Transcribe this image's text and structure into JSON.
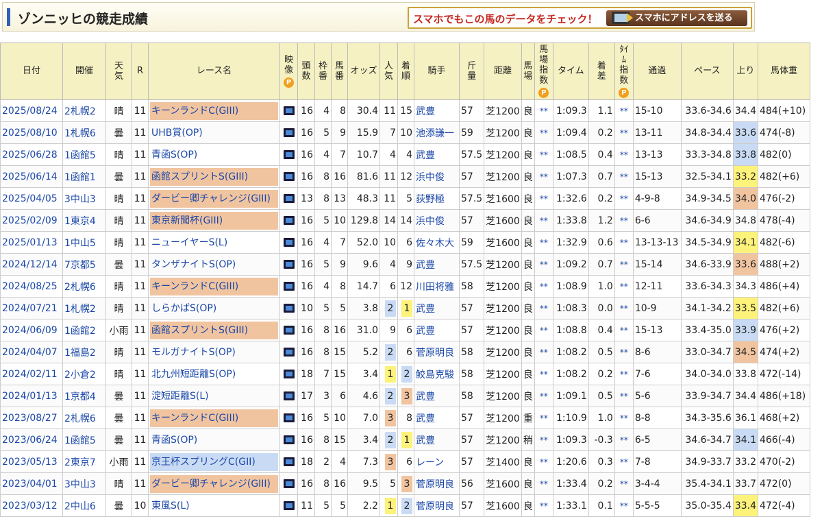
{
  "header": {
    "title": "ゾンニッヒの競走成績",
    "promo_text": "スマホでもこの馬のデータをチェック！",
    "promo_button": "スマホにアドレスを送る"
  },
  "columns": [
    "日付",
    "開催",
    "天気",
    "R",
    "レース名",
    "映像",
    "頭数",
    "枠番",
    "馬番",
    "オッズ",
    "人気",
    "着順",
    "騎手",
    "斤量",
    "距離",
    "馬場",
    "馬場指数",
    "タイム",
    "着差",
    "ﾀｲﾑ指数",
    "通過",
    "ペース",
    "上り",
    "馬体重"
  ],
  "p_mark": "P",
  "rows": [
    {
      "date": "2025/08/24",
      "kaisai": "2札幌2",
      "weather": "晴",
      "r": "11",
      "race": "キーンランドC(GIII)",
      "grade": "g3",
      "heads": "16",
      "waku": "4",
      "uma": "8",
      "odds": "30.4",
      "ninki": "11",
      "rank": "15",
      "jockey": "武豊",
      "kinryo": "57",
      "dist": "芝1200",
      "baba": "良",
      "bsi": "**",
      "time": "1:09.3",
      "diff": "1.1",
      "ti": "**",
      "pass": "15-10",
      "pace": "33.6-34.6",
      "agari": "34.4",
      "weight": "484(+10)"
    },
    {
      "date": "2025/08/10",
      "kaisai": "1札幌6",
      "weather": "曇",
      "r": "11",
      "race": "UHB賞(OP)",
      "grade": "",
      "heads": "16",
      "waku": "5",
      "uma": "9",
      "odds": "15.9",
      "ninki": "7",
      "rank": "10",
      "jockey": "池添謙一",
      "kinryo": "59",
      "dist": "芝1200",
      "baba": "良",
      "bsi": "**",
      "time": "1:09.4",
      "diff": "0.2",
      "ti": "**",
      "pass": "13-11",
      "pace": "34.8-34.4",
      "agari": "33.6",
      "agari_c": "up-b",
      "weight": "474(-8)"
    },
    {
      "date": "2025/06/28",
      "kaisai": "1函館5",
      "weather": "晴",
      "r": "11",
      "race": "青函S(OP)",
      "grade": "",
      "heads": "16",
      "waku": "4",
      "uma": "7",
      "odds": "10.7",
      "ninki": "4",
      "rank": "4",
      "jockey": "武豊",
      "kinryo": "57.5",
      "dist": "芝1200",
      "baba": "良",
      "bsi": "**",
      "time": "1:08.5",
      "diff": "0.4",
      "ti": "**",
      "pass": "13-13",
      "pace": "33.3-34.8",
      "agari": "33.8",
      "agari_c": "up-b",
      "weight": "482(0)"
    },
    {
      "date": "2025/06/14",
      "kaisai": "1函館1",
      "weather": "曇",
      "r": "11",
      "race": "函館スプリントS(GIII)",
      "grade": "g3",
      "heads": "16",
      "waku": "8",
      "uma": "16",
      "odds": "81.6",
      "ninki": "11",
      "rank": "12",
      "jockey": "浜中俊",
      "kinryo": "57",
      "dist": "芝1200",
      "baba": "良",
      "bsi": "**",
      "time": "1:07.3",
      "diff": "0.7",
      "ti": "**",
      "pass": "15-13",
      "pace": "32.5-34.1",
      "agari": "33.2",
      "agari_c": "up-y",
      "weight": "482(+6)"
    },
    {
      "date": "2025/04/05",
      "kaisai": "3中山3",
      "weather": "晴",
      "r": "11",
      "race": "ダービー卿チャレンジ(GIII)",
      "grade": "g3",
      "heads": "13",
      "waku": "8",
      "uma": "13",
      "odds": "48.3",
      "ninki": "11",
      "rank": "5",
      "jockey": "荻野極",
      "kinryo": "57.5",
      "dist": "芝1600",
      "baba": "良",
      "bsi": "**",
      "time": "1:32.6",
      "diff": "0.2",
      "ti": "**",
      "pass": "4-9-8",
      "pace": "34.9-34.5",
      "agari": "34.0",
      "agari_c": "up-o",
      "weight": "476(-2)"
    },
    {
      "date": "2025/02/09",
      "kaisai": "1東京4",
      "weather": "晴",
      "r": "11",
      "race": "東京新聞杯(GIII)",
      "grade": "g3",
      "heads": "16",
      "waku": "5",
      "uma": "10",
      "odds": "129.8",
      "ninki": "14",
      "rank": "14",
      "jockey": "浜中俊",
      "kinryo": "57",
      "dist": "芝1600",
      "baba": "良",
      "bsi": "**",
      "time": "1:33.8",
      "diff": "1.2",
      "ti": "**",
      "pass": "6-6",
      "pace": "34.6-34.9",
      "agari": "34.8",
      "weight": "478(-4)"
    },
    {
      "date": "2025/01/13",
      "kaisai": "1中山5",
      "weather": "晴",
      "r": "11",
      "race": "ニューイヤーS(L)",
      "grade": "",
      "heads": "16",
      "waku": "4",
      "uma": "7",
      "odds": "52.0",
      "ninki": "10",
      "rank": "6",
      "jockey": "佐々木大",
      "kinryo": "59",
      "dist": "芝1600",
      "baba": "良",
      "bsi": "**",
      "time": "1:32.9",
      "diff": "0.6",
      "ti": "**",
      "pass": "13-13-13",
      "pace": "34.5-34.9",
      "agari": "34.1",
      "agari_c": "up-y",
      "weight": "482(-6)"
    },
    {
      "date": "2024/12/14",
      "kaisai": "7京都5",
      "weather": "曇",
      "r": "11",
      "race": "タンザナイトS(OP)",
      "grade": "",
      "heads": "16",
      "waku": "5",
      "uma": "9",
      "odds": "9.6",
      "ninki": "4",
      "rank": "9",
      "jockey": "武豊",
      "kinryo": "57.5",
      "dist": "芝1200",
      "baba": "良",
      "bsi": "**",
      "time": "1:09.2",
      "diff": "0.7",
      "ti": "**",
      "pass": "15-14",
      "pace": "34.6-33.9",
      "agari": "33.6",
      "agari_c": "up-o",
      "weight": "488(+2)"
    },
    {
      "date": "2024/08/25",
      "kaisai": "2札幌6",
      "weather": "晴",
      "r": "11",
      "race": "キーンランドC(GIII)",
      "grade": "g3",
      "heads": "16",
      "waku": "4",
      "uma": "8",
      "odds": "14.7",
      "ninki": "6",
      "rank": "12",
      "jockey": "川田将雅",
      "kinryo": "58",
      "dist": "芝1200",
      "baba": "良",
      "bsi": "**",
      "time": "1:08.9",
      "diff": "1.0",
      "ti": "**",
      "pass": "12-11",
      "pace": "33.6-34.3",
      "agari": "34.3",
      "weight": "486(+4)"
    },
    {
      "date": "2024/07/21",
      "kaisai": "1札幌2",
      "weather": "晴",
      "r": "11",
      "race": "しらかばS(OP)",
      "grade": "",
      "heads": "10",
      "waku": "5",
      "uma": "5",
      "odds": "3.8",
      "ninki": "2",
      "ninki_c": "p2",
      "rank": "1",
      "rank_c": "p1",
      "jockey": "武豊",
      "kinryo": "57",
      "dist": "芝1200",
      "baba": "良",
      "bsi": "**",
      "time": "1:08.3",
      "diff": "0.0",
      "ti": "**",
      "pass": "10-9",
      "pace": "34.1-34.2",
      "agari": "33.5",
      "agari_c": "up-y",
      "weight": "482(+6)"
    },
    {
      "date": "2024/06/09",
      "kaisai": "1函館2",
      "weather": "小雨",
      "r": "11",
      "race": "函館スプリントS(GIII)",
      "grade": "g3",
      "heads": "16",
      "waku": "8",
      "uma": "16",
      "odds": "31.0",
      "ninki": "9",
      "rank": "6",
      "jockey": "武豊",
      "kinryo": "57",
      "dist": "芝1200",
      "baba": "良",
      "bsi": "**",
      "time": "1:08.8",
      "diff": "0.4",
      "ti": "**",
      "pass": "15-13",
      "pace": "33.4-35.0",
      "agari": "33.9",
      "agari_c": "up-b",
      "weight": "476(+2)"
    },
    {
      "date": "2024/04/07",
      "kaisai": "1福島2",
      "weather": "晴",
      "r": "11",
      "race": "モルガナイトS(OP)",
      "grade": "",
      "heads": "16",
      "waku": "8",
      "uma": "15",
      "odds": "5.2",
      "ninki": "2",
      "ninki_c": "p2",
      "rank": "6",
      "jockey": "菅原明良",
      "kinryo": "58",
      "dist": "芝1200",
      "baba": "良",
      "bsi": "**",
      "time": "1:08.2",
      "diff": "0.5",
      "ti": "**",
      "pass": "8-6",
      "pace": "33.0-34.7",
      "agari": "34.5",
      "agari_c": "up-o",
      "weight": "474(+2)"
    },
    {
      "date": "2024/02/11",
      "kaisai": "2小倉2",
      "weather": "晴",
      "r": "11",
      "race": "北九州短距離S(OP)",
      "grade": "",
      "heads": "18",
      "waku": "7",
      "uma": "15",
      "odds": "3.4",
      "ninki": "1",
      "ninki_c": "p1",
      "rank": "2",
      "rank_c": "p2",
      "jockey": "鮫島克駿",
      "kinryo": "58",
      "dist": "芝1200",
      "baba": "良",
      "bsi": "**",
      "time": "1:08.2",
      "diff": "0.2",
      "ti": "**",
      "pass": "7-6",
      "pace": "34.0-34.0",
      "agari": "33.8",
      "weight": "472(-14)"
    },
    {
      "date": "2024/01/13",
      "kaisai": "1京都4",
      "weather": "曇",
      "r": "11",
      "race": "淀短距離S(L)",
      "grade": "",
      "heads": "17",
      "waku": "3",
      "uma": "6",
      "odds": "4.6",
      "ninki": "2",
      "ninki_c": "p2",
      "rank": "3",
      "rank_c": "p3",
      "jockey": "武豊",
      "kinryo": "58",
      "dist": "芝1200",
      "baba": "良",
      "bsi": "**",
      "time": "1:09.1",
      "diff": "0.5",
      "ti": "**",
      "pass": "5-6",
      "pace": "33.9-34.7",
      "agari": "34.4",
      "weight": "486(+18)"
    },
    {
      "date": "2023/08/27",
      "kaisai": "2札幌6",
      "weather": "曇",
      "r": "11",
      "race": "キーンランドC(GIII)",
      "grade": "g3",
      "heads": "16",
      "waku": "5",
      "uma": "10",
      "odds": "7.0",
      "ninki": "3",
      "ninki_c": "p3",
      "rank": "8",
      "jockey": "武豊",
      "kinryo": "57",
      "dist": "芝1200",
      "baba": "重",
      "bsi": "**",
      "time": "1:10.9",
      "diff": "1.0",
      "ti": "**",
      "pass": "8-8",
      "pace": "34.3-35.6",
      "agari": "36.1",
      "weight": "468(+2)"
    },
    {
      "date": "2023/06/24",
      "kaisai": "1函館5",
      "weather": "曇",
      "r": "11",
      "race": "青函S(OP)",
      "grade": "",
      "heads": "16",
      "waku": "8",
      "uma": "15",
      "odds": "3.4",
      "ninki": "2",
      "ninki_c": "p2",
      "rank": "1",
      "rank_c": "p1",
      "jockey": "武豊",
      "kinryo": "57",
      "dist": "芝1200",
      "baba": "稍",
      "bsi": "**",
      "time": "1:09.3",
      "diff": "-0.3",
      "ti": "**",
      "pass": "6-5",
      "pace": "34.6-34.7",
      "agari": "34.1",
      "agari_c": "up-b",
      "weight": "466(-4)"
    },
    {
      "date": "2023/05/13",
      "kaisai": "2東京7",
      "weather": "小雨",
      "r": "11",
      "race": "京王杯スプリングC(GII)",
      "grade": "g2",
      "heads": "18",
      "waku": "2",
      "uma": "4",
      "odds": "7.3",
      "ninki": "3",
      "ninki_c": "p3",
      "rank": "6",
      "jockey": "レーン",
      "kinryo": "57",
      "dist": "芝1400",
      "baba": "良",
      "bsi": "**",
      "time": "1:20.6",
      "diff": "0.3",
      "ti": "**",
      "pass": "7-8",
      "pace": "34.9-33.7",
      "agari": "33.2",
      "weight": "470(-2)"
    },
    {
      "date": "2023/04/01",
      "kaisai": "3中山3",
      "weather": "晴",
      "r": "11",
      "race": "ダービー卿チャレンジ(GIII)",
      "grade": "g3",
      "heads": "16",
      "waku": "8",
      "uma": "16",
      "odds": "9.5",
      "ninki": "5",
      "rank": "3",
      "rank_c": "p3",
      "jockey": "菅原明良",
      "kinryo": "56",
      "dist": "芝1600",
      "baba": "良",
      "bsi": "**",
      "time": "1:33.4",
      "diff": "0.2",
      "ti": "**",
      "pass": "3-4-4",
      "pace": "35.4-34.1",
      "agari": "33.7",
      "weight": "472(0)"
    },
    {
      "date": "2023/03/12",
      "kaisai": "2中山6",
      "weather": "曇",
      "r": "10",
      "race": "東風S(L)",
      "grade": "",
      "heads": "11",
      "waku": "5",
      "uma": "5",
      "odds": "2.2",
      "ninki": "1",
      "ninki_c": "p1",
      "rank": "2",
      "rank_c": "p2",
      "jockey": "菅原明良",
      "kinryo": "57",
      "dist": "芝1600",
      "baba": "良",
      "bsi": "**",
      "time": "1:33.1",
      "diff": "0.1",
      "ti": "**",
      "pass": "5-5-5",
      "pace": "35.0-35.4",
      "agari": "33.4",
      "agari_c": "up-y",
      "weight": "472(-4)"
    }
  ]
}
